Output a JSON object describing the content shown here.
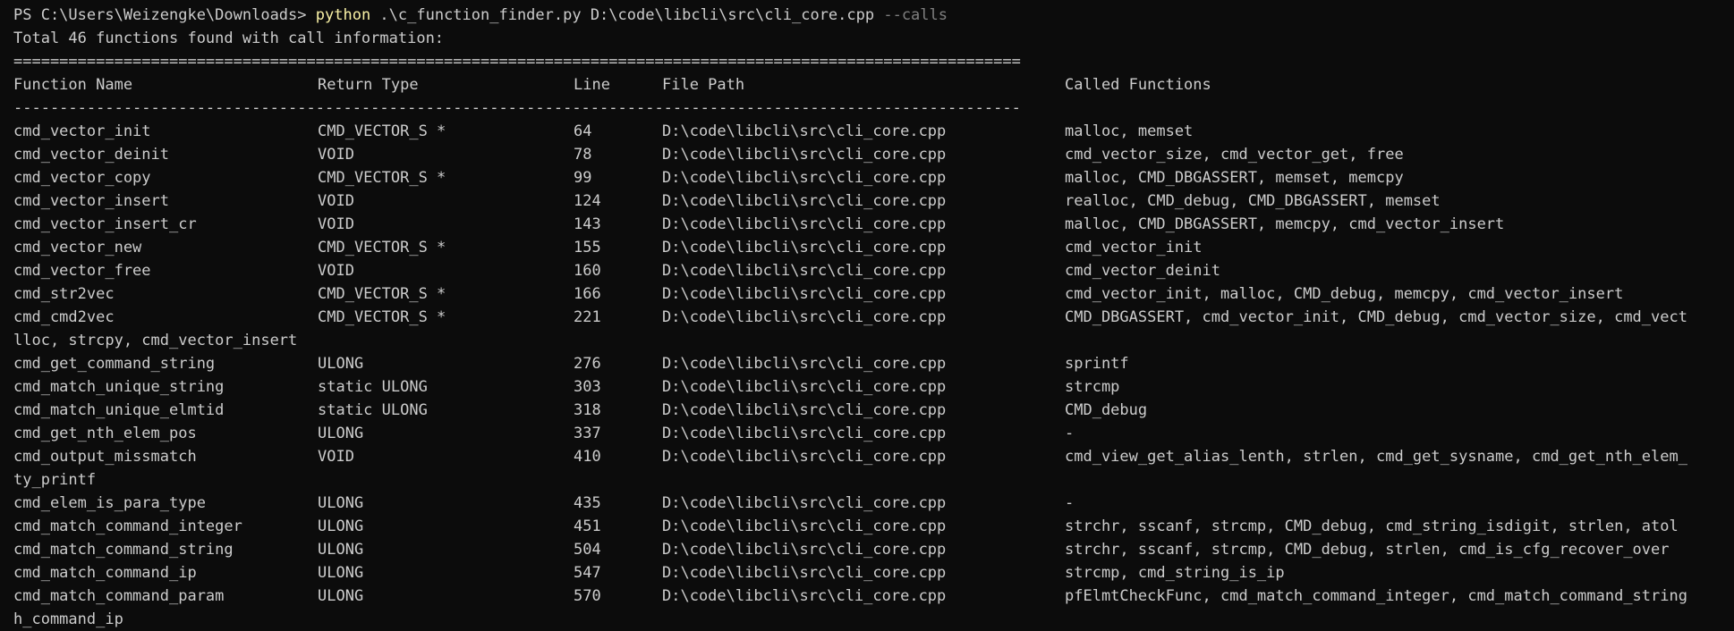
{
  "terminal": {
    "prompt": "PS C:\\Users\\Weizengke\\Downloads> ",
    "command": "python",
    "args": " .\\c_function_finder.py D:\\code\\libcli\\src\\cli_core.cpp ",
    "flag": "--calls",
    "summary": "Total 46 functions found with call information:",
    "separator_double": "==============================================================================================================",
    "separator_single": "--------------------------------------------------------------------------------------------------------------",
    "headers": {
      "function_name": "Function Name",
      "return_type": "Return Type",
      "line": "Line",
      "file_path": "File Path",
      "called_functions": "Called Functions"
    },
    "rows": [
      {
        "name": "cmd_vector_init",
        "ret": "CMD_VECTOR_S *",
        "line": "64",
        "path": "D:\\code\\libcli\\src\\cli_core.cpp",
        "calls": "malloc, memset",
        "wrap": ""
      },
      {
        "name": "cmd_vector_deinit",
        "ret": "VOID",
        "line": "78",
        "path": "D:\\code\\libcli\\src\\cli_core.cpp",
        "calls": "cmd_vector_size, cmd_vector_get, free",
        "wrap": ""
      },
      {
        "name": "cmd_vector_copy",
        "ret": "CMD_VECTOR_S *",
        "line": "99",
        "path": "D:\\code\\libcli\\src\\cli_core.cpp",
        "calls": "malloc, CMD_DBGASSERT, memset, memcpy",
        "wrap": ""
      },
      {
        "name": "cmd_vector_insert",
        "ret": "VOID",
        "line": "124",
        "path": "D:\\code\\libcli\\src\\cli_core.cpp",
        "calls": "realloc, CMD_debug, CMD_DBGASSERT, memset",
        "wrap": ""
      },
      {
        "name": "cmd_vector_insert_cr",
        "ret": "VOID",
        "line": "143",
        "path": "D:\\code\\libcli\\src\\cli_core.cpp",
        "calls": "malloc, CMD_DBGASSERT, memcpy, cmd_vector_insert",
        "wrap": ""
      },
      {
        "name": "cmd_vector_new",
        "ret": "CMD_VECTOR_S *",
        "line": "155",
        "path": "D:\\code\\libcli\\src\\cli_core.cpp",
        "calls": "cmd_vector_init",
        "wrap": ""
      },
      {
        "name": "cmd_vector_free",
        "ret": "VOID",
        "line": "160",
        "path": "D:\\code\\libcli\\src\\cli_core.cpp",
        "calls": "cmd_vector_deinit",
        "wrap": ""
      },
      {
        "name": "cmd_str2vec",
        "ret": "CMD_VECTOR_S *",
        "line": "166",
        "path": "D:\\code\\libcli\\src\\cli_core.cpp",
        "calls": "cmd_vector_init, malloc, CMD_debug, memcpy, cmd_vector_insert",
        "wrap": ""
      },
      {
        "name": "cmd_cmd2vec",
        "ret": "CMD_VECTOR_S *",
        "line": "221",
        "path": "D:\\code\\libcli\\src\\cli_core.cpp",
        "calls": "CMD_DBGASSERT, cmd_vector_init, CMD_debug, cmd_vector_size, cmd_vect",
        "wrap": "lloc, strcpy, cmd_vector_insert"
      },
      {
        "name": "cmd_get_command_string",
        "ret": "ULONG",
        "line": "276",
        "path": "D:\\code\\libcli\\src\\cli_core.cpp",
        "calls": "sprintf",
        "wrap": ""
      },
      {
        "name": "cmd_match_unique_string",
        "ret": "static ULONG",
        "line": "303",
        "path": "D:\\code\\libcli\\src\\cli_core.cpp",
        "calls": "strcmp",
        "wrap": ""
      },
      {
        "name": "cmd_match_unique_elmtid",
        "ret": "static ULONG",
        "line": "318",
        "path": "D:\\code\\libcli\\src\\cli_core.cpp",
        "calls": "CMD_debug",
        "wrap": ""
      },
      {
        "name": "cmd_get_nth_elem_pos",
        "ret": "ULONG",
        "line": "337",
        "path": "D:\\code\\libcli\\src\\cli_core.cpp",
        "calls": "-",
        "wrap": ""
      },
      {
        "name": "cmd_output_missmatch",
        "ret": "VOID",
        "line": "410",
        "path": "D:\\code\\libcli\\src\\cli_core.cpp",
        "calls": "cmd_view_get_alias_lenth, strlen, cmd_get_sysname, cmd_get_nth_elem_",
        "wrap": "ty_printf"
      },
      {
        "name": "cmd_elem_is_para_type",
        "ret": "ULONG",
        "line": "435",
        "path": "D:\\code\\libcli\\src\\cli_core.cpp",
        "calls": "-",
        "wrap": ""
      },
      {
        "name": "cmd_match_command_integer",
        "ret": "ULONG",
        "line": "451",
        "path": "D:\\code\\libcli\\src\\cli_core.cpp",
        "calls": "strchr, sscanf, strcmp, CMD_debug, cmd_string_isdigit, strlen, atol",
        "wrap": ""
      },
      {
        "name": "cmd_match_command_string",
        "ret": "ULONG",
        "line": "504",
        "path": "D:\\code\\libcli\\src\\cli_core.cpp",
        "calls": "strchr, sscanf, strcmp, CMD_debug, strlen, cmd_is_cfg_recover_over",
        "wrap": ""
      },
      {
        "name": "cmd_match_command_ip",
        "ret": "ULONG",
        "line": "547",
        "path": "D:\\code\\libcli\\src\\cli_core.cpp",
        "calls": "strcmp, cmd_string_is_ip",
        "wrap": ""
      },
      {
        "name": "cmd_match_command_param",
        "ret": "ULONG",
        "line": "570",
        "path": "D:\\code\\libcli\\src\\cli_core.cpp",
        "calls": "pfElmtCheckFunc, cmd_match_command_integer, cmd_match_command_string",
        "wrap": "h_command_ip"
      }
    ]
  }
}
